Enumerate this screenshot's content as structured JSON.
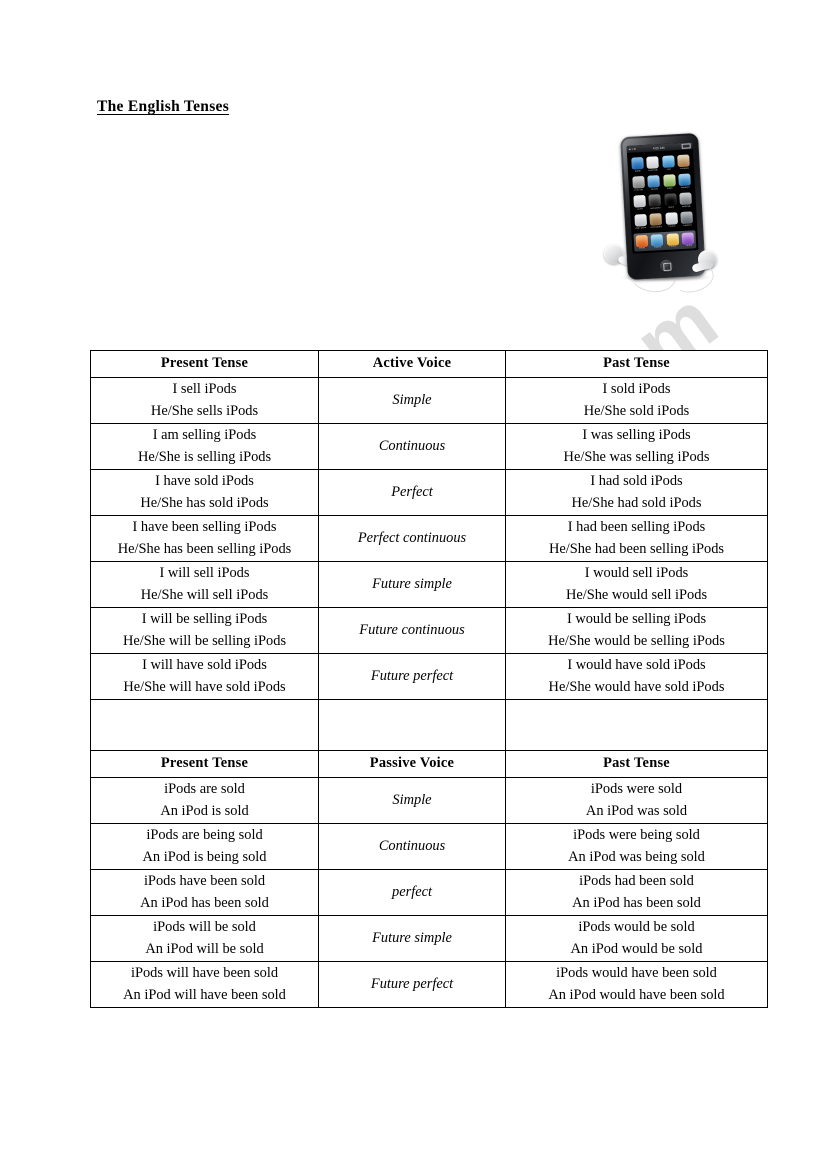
{
  "document": {
    "title": "The English Tenses",
    "watermark": "ESLprintables.com"
  },
  "illustration": {
    "name": "ipod-touch",
    "status_time": "4:05 AM",
    "apps": [
      {
        "label": "Safari",
        "color1": "#4a9ee0",
        "color2": "#1d5fa8"
      },
      {
        "label": "Calendar",
        "color1": "#f4f4f4",
        "color2": "#c9ccd1"
      },
      {
        "label": "Mail",
        "color1": "#8fd2f5",
        "color2": "#2a7fc4"
      },
      {
        "label": "Contacts",
        "color1": "#d9c4a3",
        "color2": "#a8763f"
      },
      {
        "label": "YouTube",
        "color1": "#c8c8c8",
        "color2": "#7d7d7d"
      },
      {
        "label": "Stocks",
        "color1": "#8cc8ef",
        "color2": "#2b6fae"
      },
      {
        "label": "Maps",
        "color1": "#cfe3a8",
        "color2": "#7ba84d"
      },
      {
        "label": "Weather",
        "color1": "#79c4ef",
        "color2": "#2268a8"
      },
      {
        "label": "Clock",
        "color1": "#f2f2f2",
        "color2": "#b8babe"
      },
      {
        "label": "Calculator",
        "color1": "#585858",
        "color2": "#161616"
      },
      {
        "label": "Notes",
        "color1": "#f6edбb",
        "color2": "#e0cf78"
      },
      {
        "label": "Settings",
        "color1": "#b7b9bd",
        "color2": "#6d7074"
      },
      {
        "label": "App Store",
        "color1": "#eceef0",
        "color2": "#b2b6bb"
      },
      {
        "label": "Newsstand",
        "color1": "#c9a87a",
        "color2": "#8a6438"
      },
      {
        "label": "Photos",
        "color1": "#f0f1f3",
        "color2": "#c4c7cb"
      },
      {
        "label": "Camera",
        "color1": "#9aa0a6",
        "color2": "#5a6067"
      }
    ],
    "dock_apps": [
      {
        "label": "Music",
        "color1": "#f6a24a",
        "color2": "#d2541c"
      },
      {
        "label": "Videos",
        "color1": "#8ed0f2",
        "color2": "#2f7cb8"
      },
      {
        "label": "Photos",
        "color1": "#fbe08a",
        "color2": "#e0a72f"
      },
      {
        "label": "iTunes",
        "color1": "#c48ee8",
        "color2": "#7a3fb5"
      }
    ]
  },
  "table": {
    "active": {
      "headers": {
        "left": "Present Tense",
        "middle": "Active Voice",
        "right": "Past Tense"
      },
      "rows": [
        {
          "voice": "Simple",
          "present": [
            "I sell iPods",
            "He/She sells iPods"
          ],
          "past": [
            "I sold iPods",
            "He/She sold iPods"
          ]
        },
        {
          "voice": "Continuous",
          "present": [
            "I am selling iPods",
            "He/She is selling iPods"
          ],
          "past": [
            "I was selling iPods",
            "He/She was selling iPods"
          ]
        },
        {
          "voice": "Perfect",
          "present": [
            "I have sold iPods",
            "He/She has sold iPods"
          ],
          "past": [
            "I had sold iPods",
            "He/She had sold iPods"
          ]
        },
        {
          "voice": "Perfect continuous",
          "present": [
            "I have been selling iPods",
            "He/She has been selling iPods"
          ],
          "past": [
            "I had been selling iPods",
            "He/She had been selling iPods"
          ]
        },
        {
          "voice": "Future simple",
          "present": [
            "I will sell iPods",
            "He/She will sell iPods"
          ],
          "past": [
            "I would sell iPods",
            "He/She would sell iPods"
          ]
        },
        {
          "voice": "Future continuous",
          "present": [
            "I will be selling iPods",
            "He/She will be selling iPods"
          ],
          "past": [
            "I would be selling iPods",
            "He/She would be selling iPods"
          ]
        },
        {
          "voice": "Future perfect",
          "present": [
            "I will have sold iPods",
            "He/She will have sold iPods"
          ],
          "past": [
            "I would have sold iPods",
            "He/She would have sold iPods"
          ]
        }
      ]
    },
    "passive": {
      "headers": {
        "left": "Present Tense",
        "middle": "Passive Voice",
        "right": "Past Tense"
      },
      "rows": [
        {
          "voice": "Simple",
          "present": [
            "iPods are sold",
            "An iPod is sold"
          ],
          "past": [
            "iPods were sold",
            "An iPod was sold"
          ]
        },
        {
          "voice": "Continuous",
          "present": [
            "iPods are being sold",
            "An iPod is being sold"
          ],
          "past": [
            "iPods were being sold",
            "An iPod was being sold"
          ]
        },
        {
          "voice": "perfect",
          "present": [
            "iPods have been sold",
            "An iPod has been sold"
          ],
          "past": [
            "iPods had been sold",
            "An iPod has been sold"
          ]
        },
        {
          "voice": "Future simple",
          "present": [
            "iPods will be sold",
            "An iPod will be sold"
          ],
          "past": [
            "iPods would be sold",
            "An iPod would be sold"
          ]
        },
        {
          "voice": "Future perfect",
          "present": [
            "iPods will have been sold",
            "An iPod will have been sold"
          ],
          "past": [
            "iPods would have been sold",
            "An iPod would have been sold"
          ]
        }
      ]
    }
  }
}
